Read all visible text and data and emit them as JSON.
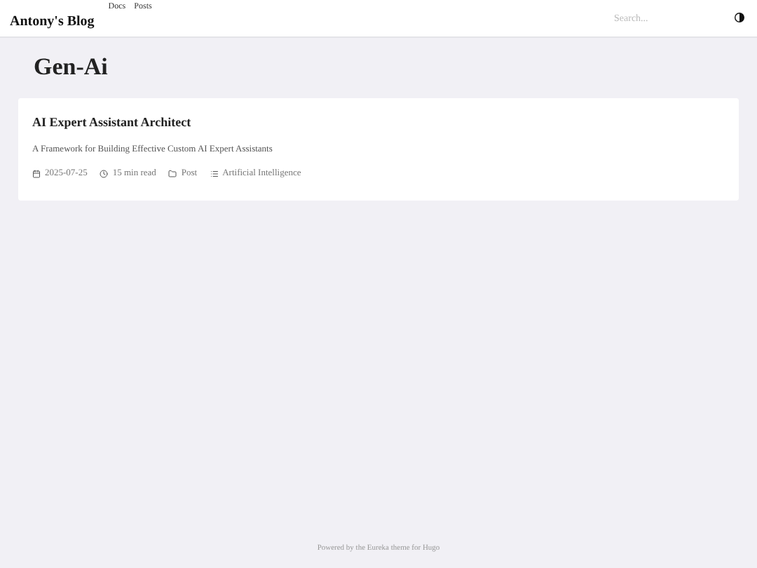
{
  "header": {
    "brand": "Antony's Blog",
    "nav": [
      "Docs",
      "Posts"
    ],
    "search": {
      "placeholder": "Search..."
    }
  },
  "page": {
    "title": "Gen-Ai"
  },
  "posts": [
    {
      "title": "AI Expert Assistant Architect",
      "summary": "A Framework for Building Effective Custom AI Expert Assistants",
      "date": "2025-07-25",
      "read_time": "15 min read",
      "type": "Post",
      "category": "Artificial Intelligence"
    }
  ],
  "footer": "Powered by the Eureka theme for Hugo"
}
